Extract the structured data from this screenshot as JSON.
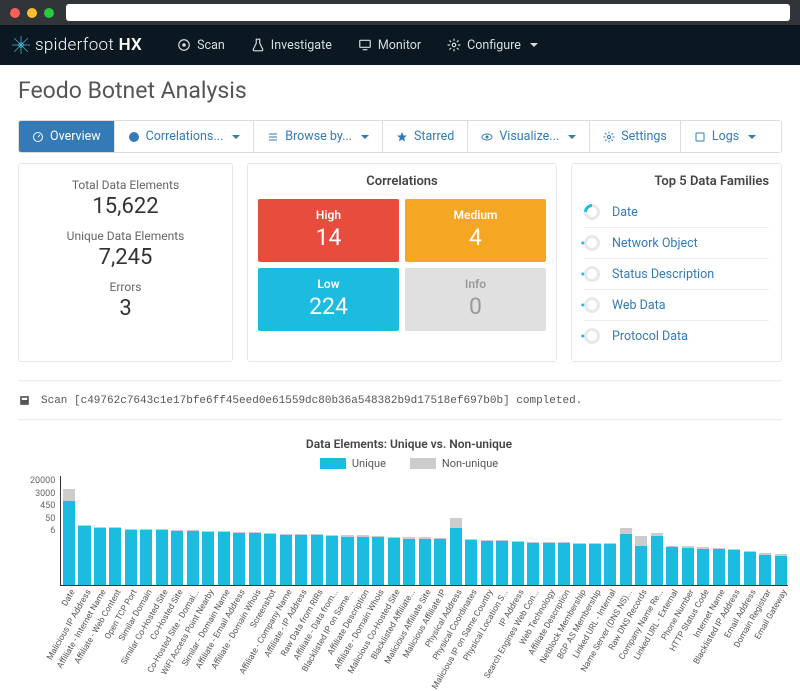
{
  "app": {
    "name": "spiderfoot",
    "suffix": "HX"
  },
  "nav": {
    "scan": "Scan",
    "investigate": "Investigate",
    "monitor": "Monitor",
    "configure": "Configure"
  },
  "page_title": "Feodo Botnet Analysis",
  "tabs": {
    "overview": "Overview",
    "correlations": "Correlations...",
    "browse": "Browse by...",
    "starred": "Starred",
    "visualize": "Visualize...",
    "settings": "Settings",
    "logs": "Logs"
  },
  "stats": {
    "total_label": "Total Data Elements",
    "total_value": "15,622",
    "unique_label": "Unique Data Elements",
    "unique_value": "7,245",
    "errors_label": "Errors",
    "errors_value": "3"
  },
  "correlations": {
    "title": "Correlations",
    "high_label": "High",
    "high_value": "14",
    "medium_label": "Medium",
    "medium_value": "4",
    "low_label": "Low",
    "low_value": "224",
    "info_label": "Info",
    "info_value": "0"
  },
  "families": {
    "title": "Top 5 Data Families",
    "items": [
      "Date",
      "Network Object",
      "Status Description",
      "Web Data",
      "Protocol Data"
    ]
  },
  "log": {
    "text": "Scan [c49762c7643c1e17bfe6ff45eed0e61559dc80b36a548382b9d17518ef697b0b] completed."
  },
  "chart_data": {
    "type": "bar",
    "title": "Data Elements: Unique vs. Non-unique",
    "series_names": {
      "unique": "Unique",
      "nonunique": "Non-unique"
    },
    "ylabel": "",
    "yticks": [
      "20000",
      "3000",
      "450",
      "50",
      "6"
    ],
    "categories": [
      "Date",
      "Malicious IP Address",
      "Affiliate - Internet Name",
      "Affiliate - Web Content",
      "Open TCP Port",
      "Similar Domain",
      "Similar Co-Hosted Site",
      "Co-Hosted Site",
      "Co-Hosted Site - Domai...",
      "WiFi Access Point Nearby",
      "Similar - Domain Name",
      "Affiliate - Email Address",
      "Affiliate - Domain Whois",
      "Screenshot",
      "Affiliate - Company Name",
      "Affiliate - IP Address",
      "Raw Data from RIRs",
      "Affiliate - Data from...",
      "Blacklisted IP on Same...",
      "Affiliate Description",
      "Affiliate - Domain Whois",
      "Malicious Co-Hosted Site",
      "Blacklisted Affiliate...",
      "Malicious Affiliate Site",
      "Malicious Affiliate IP",
      "Physical Address",
      "Physical Coordinates",
      "Malicious IP on Same Country",
      "Physical Location S...",
      "IP Address",
      "Search Engines Web Con...",
      "Web Technology",
      "Affiliate Description",
      "Netblock Membership",
      "BGP AS Membership",
      "Linked URL - Internal",
      "Name Server (DNS NS)...",
      "Raw DNS Records",
      "Company Name Re...",
      "Linked URL - External",
      "Phone Number",
      "HTTP Status Code",
      "Internet Name",
      "Blacklisted IP Address",
      "Email Address",
      "Domain Registrar",
      "Email Gateway"
    ],
    "series": [
      {
        "name": "Unique",
        "values": [
          3000,
          430,
          380,
          370,
          330,
          330,
          320,
          310,
          300,
          280,
          280,
          260,
          260,
          240,
          230,
          230,
          220,
          210,
          200,
          200,
          190,
          180,
          170,
          170,
          160,
          380,
          150,
          140,
          140,
          130,
          120,
          120,
          120,
          110,
          110,
          110,
          250,
          100,
          210,
          90,
          85,
          80,
          75,
          70,
          60,
          50,
          45
        ]
      },
      {
        "name": "Non-unique",
        "values": [
          4500,
          50,
          40,
          40,
          30,
          30,
          30,
          30,
          30,
          25,
          25,
          25,
          25,
          22,
          22,
          20,
          20,
          20,
          20,
          18,
          18,
          18,
          17,
          17,
          17,
          450,
          15,
          14,
          14,
          14,
          13,
          13,
          13,
          12,
          12,
          12,
          120,
          110,
          60,
          10,
          10,
          10,
          10,
          9,
          9,
          8,
          8
        ]
      }
    ]
  }
}
